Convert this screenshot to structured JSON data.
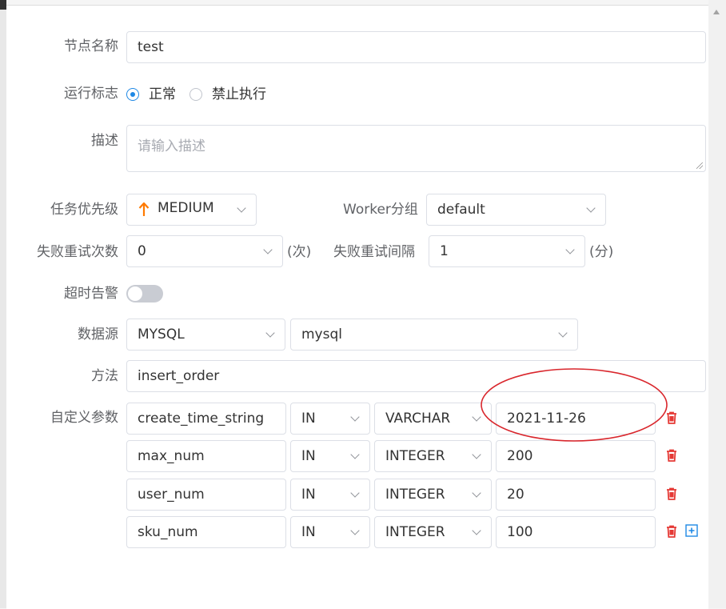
{
  "form": {
    "node_name": {
      "label": "节点名称",
      "value": "test"
    },
    "run_flag": {
      "label": "运行标志",
      "options": [
        "正常",
        "禁止执行"
      ],
      "selected": "正常"
    },
    "description": {
      "label": "描述",
      "placeholder": "请输入描述"
    },
    "priority": {
      "label": "任务优先级",
      "value": "MEDIUM"
    },
    "worker_group": {
      "label": "Worker分组",
      "value": "default"
    },
    "retry_times": {
      "label": "失败重试次数",
      "value": "0",
      "unit": "(次)"
    },
    "retry_interval": {
      "label": "失败重试间隔",
      "value": "1",
      "unit": "(分)"
    },
    "timeout_alarm": {
      "label": "超时告警",
      "enabled": false
    },
    "datasource": {
      "label": "数据源",
      "type": "MYSQL",
      "instance": "mysql"
    },
    "method": {
      "label": "方法",
      "value": "insert_order"
    },
    "custom_params": {
      "label": "自定义参数",
      "rows": [
        {
          "prop": "create_time_string",
          "direct": "IN",
          "type": "VARCHAR",
          "value": "2021-11-26"
        },
        {
          "prop": "max_num",
          "direct": "IN",
          "type": "INTEGER",
          "value": "200"
        },
        {
          "prop": "user_num",
          "direct": "IN",
          "type": "INTEGER",
          "value": "20"
        },
        {
          "prop": "sku_num",
          "direct": "IN",
          "type": "INTEGER",
          "value": "100"
        }
      ]
    }
  },
  "colors": {
    "accent": "#1e88e5",
    "priority_arrow": "#ff7a00",
    "delete": "#e53935",
    "annotation": "#d9262c"
  },
  "icons": {
    "priority": "arrow-up-icon",
    "delete": "trash-icon",
    "add": "plus-square-icon"
  }
}
